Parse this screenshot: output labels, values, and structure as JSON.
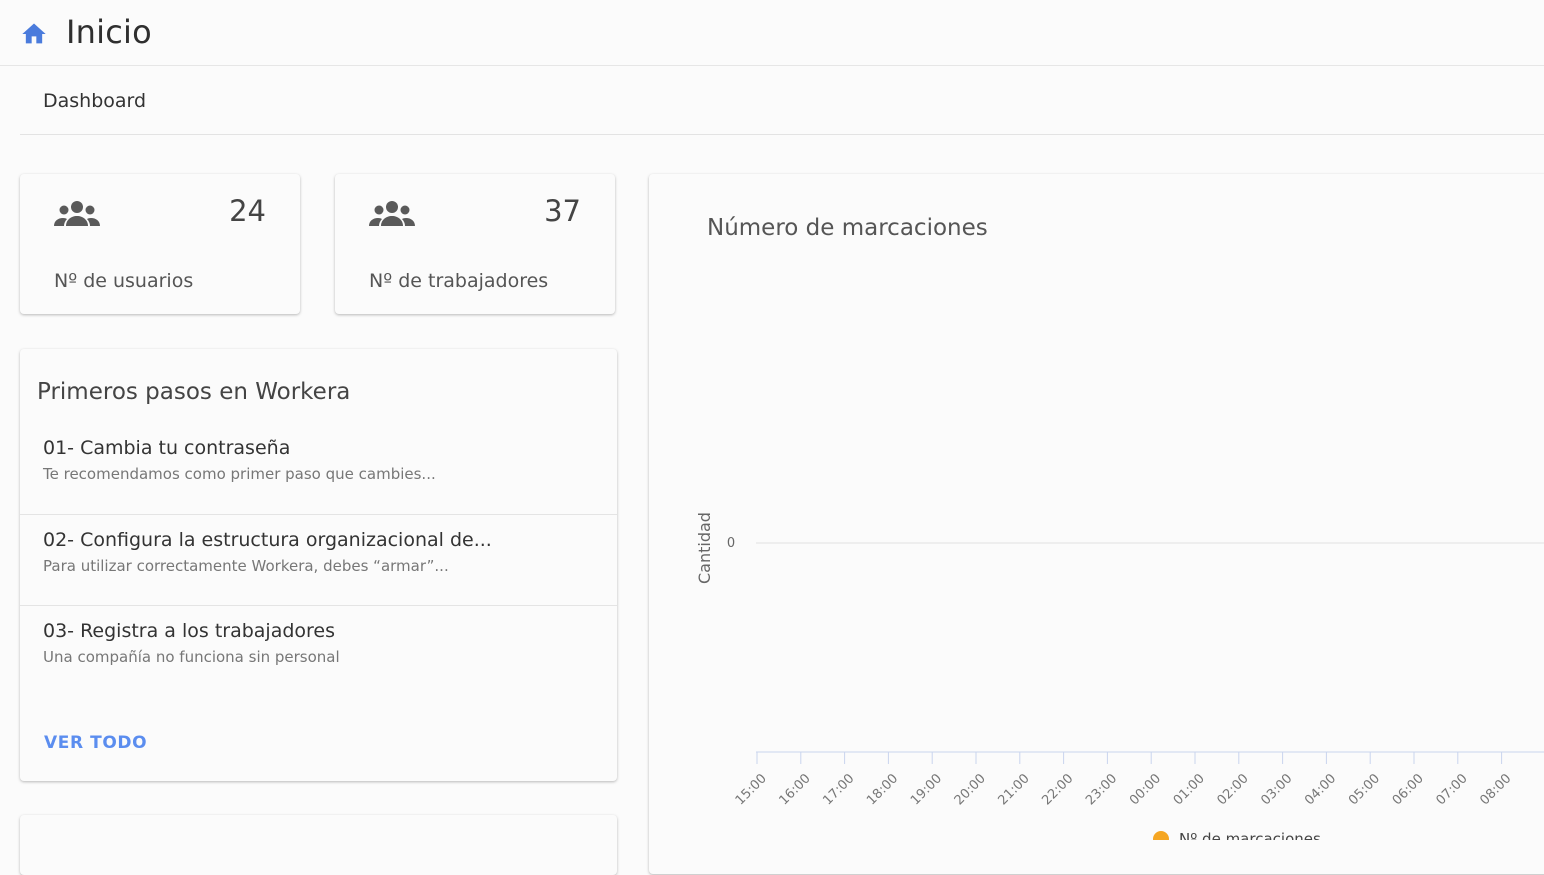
{
  "header": {
    "title": "Inicio",
    "icon": "home-icon",
    "accent": "#4a7bdc"
  },
  "breadcrumb": {
    "current": "Dashboard"
  },
  "stats": [
    {
      "value": "24",
      "label": "Nº de usuarios",
      "icon": "users-icon"
    },
    {
      "value": "37",
      "label": "Nº de trabajadores",
      "icon": "users-icon"
    }
  ],
  "steps": {
    "title": "Primeros pasos en Workera",
    "items": [
      {
        "title": "01- Cambia tu contraseña",
        "desc": "Te recomendamos como primer paso que cambies..."
      },
      {
        "title": "02- Configura la estructura organizacional de...",
        "desc": "Para utilizar correctamente Workera, debes “armar”..."
      },
      {
        "title": "03- Registra a los trabajadores",
        "desc": "Una compañía no funciona sin personal"
      }
    ],
    "see_all": "VER TODO"
  },
  "chart_data": {
    "type": "line",
    "title": "Número de marcaciones",
    "ylabel": "Cantidad",
    "xlabel": "",
    "x": [
      "15:00",
      "16:00",
      "17:00",
      "18:00",
      "19:00",
      "20:00",
      "21:00",
      "22:00",
      "23:00",
      "00:00",
      "01:00",
      "02:00",
      "03:00",
      "04:00",
      "05:00",
      "06:00",
      "07:00",
      "08:00"
    ],
    "y_ticks": [
      "0"
    ],
    "series": [
      {
        "name": "Nº de marcaciones",
        "values": [],
        "color": "#f5a623"
      }
    ],
    "legend": "bottom",
    "grid": true
  }
}
